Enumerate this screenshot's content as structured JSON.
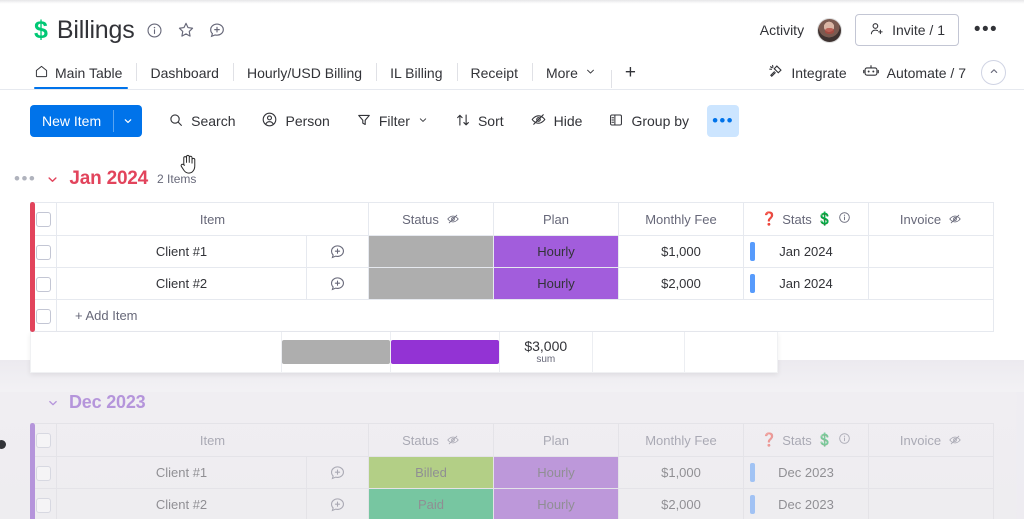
{
  "board": {
    "logo_icon": "dollar-sign-icon",
    "title": "Billings",
    "info_icon": "info-circle-icon",
    "favorite_icon": "star-icon",
    "update_icon": "add-update-icon",
    "activity_label": "Activity",
    "invite_label": "Invite / 1",
    "more_label": "•••"
  },
  "tabs": {
    "items": [
      {
        "label": "Main Table",
        "icon": "home-icon",
        "active": true
      },
      {
        "label": "Dashboard",
        "active": false
      },
      {
        "label": "Hourly/USD Billing",
        "active": false
      },
      {
        "label": "IL Billing",
        "active": false
      },
      {
        "label": "Receipt",
        "active": false
      },
      {
        "label": "More",
        "active": false,
        "has_chevron": true
      }
    ],
    "add_label": "+",
    "right": [
      {
        "label": "Integrate",
        "icon": "integrate-icon"
      },
      {
        "label": "Automate / 7",
        "icon": "robot-icon"
      }
    ],
    "collapse_icon": "chevron-up-icon"
  },
  "toolbar": {
    "new_item_label": "New Item",
    "new_item_chevron": "chevron-down-icon",
    "items": [
      {
        "label": "Search",
        "icon": "search-icon"
      },
      {
        "label": "Person",
        "icon": "person-icon"
      },
      {
        "label": "Filter",
        "icon": "filter-icon",
        "has_chevron": true
      },
      {
        "label": "Sort",
        "icon": "sort-icon"
      },
      {
        "label": "Hide",
        "icon": "eye-off-icon"
      },
      {
        "label": "Group by",
        "icon": "group-by-icon"
      }
    ],
    "more_label": "•••"
  },
  "columns": {
    "item": "Item",
    "status": "Status",
    "plan": "Plan",
    "monthly_fee": "Monthly Fee",
    "stats": "Stats",
    "stats_prefix_emoji": "❓",
    "stats_suffix_emoji": "💲",
    "invoice": "Invoice"
  },
  "groups": [
    {
      "name": "Jan 2024",
      "count_label": "2 Items",
      "color": "#e2445c",
      "collapse_icon": "chevron-down-icon",
      "menu_icon": "group-menu-icon",
      "rows": [
        {
          "item": "Client #1",
          "status": "",
          "status_color": "#aeaeae",
          "plan": "Hourly",
          "plan_color": "#a25ddc",
          "monthly_fee": "$1,000",
          "stats": "Jan 2024",
          "invoice": ""
        },
        {
          "item": "Client #2",
          "status": "",
          "status_color": "#aeaeae",
          "plan": "Hourly",
          "plan_color": "#a25ddc",
          "monthly_fee": "$2,000",
          "stats": "Jan 2024",
          "invoice": ""
        }
      ],
      "add_item_label": "+ Add Item",
      "summary": {
        "status_bar_color": "#aeaeae",
        "plan_bar_color": "#9333d4",
        "fee_value": "$3,000",
        "fee_label": "sum"
      }
    },
    {
      "name": "Dec 2023",
      "count_label": "",
      "color": "#7e3ec8",
      "collapse_icon": "chevron-down-icon",
      "rows": [
        {
          "item": "Client #1",
          "status": "Billed",
          "status_color": "#7ab51d",
          "plan": "Hourly",
          "plan_color": "#8e45c7",
          "monthly_fee": "$1,000",
          "stats": "Dec 2023",
          "invoice": ""
        },
        {
          "item": "Client #2",
          "status": "Paid",
          "status_color": "#00a254",
          "plan": "Hourly",
          "plan_color": "#8e45c7",
          "monthly_fee": "$2,000",
          "stats": "Dec 2023",
          "invoice": ""
        }
      ]
    }
  ],
  "accents": {
    "primary_blue": "#0073ea",
    "stats_bar_blue": "#579bfc",
    "green_logo": "#00c875"
  }
}
